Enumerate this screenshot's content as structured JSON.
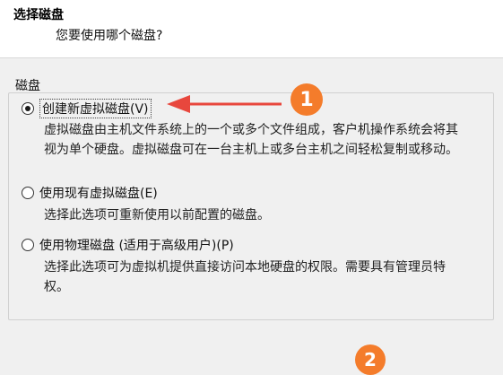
{
  "header": {
    "title": "选择磁盘",
    "subtitle": "您要使用哪个磁盘?"
  },
  "disk_group": {
    "label": "磁盘",
    "options": [
      {
        "label": "创建新虚拟磁盘(V)",
        "selected": true,
        "description_lines": [
          "虚拟磁盘由主机文件系统上的一个或多个文件组成，客户机操作系统会将其",
          "视为单个硬盘。虚拟磁盘可在一台主机上或多台主机之间轻松复制或移动。"
        ]
      },
      {
        "label": "使用现有虚拟磁盘(E)",
        "selected": false,
        "description_lines": [
          "选择此选项可重新使用以前配置的磁盘。"
        ]
      },
      {
        "label": "使用物理磁盘 (适用于高级用户)(P)",
        "selected": false,
        "description_lines": [
          "选择此选项可为虚拟机提供直接访问本地硬盘的权限。需要具有管理员特",
          "权。"
        ]
      }
    ]
  },
  "annotations": {
    "badge_1": "1",
    "badge_2": "2",
    "accent_color": "#f47c2b",
    "arrow_color": "#e8473d"
  }
}
